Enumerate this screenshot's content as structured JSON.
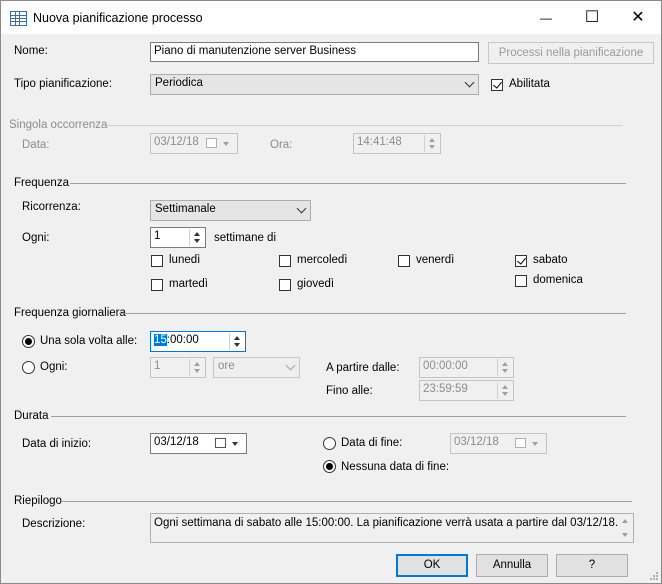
{
  "window": {
    "title": "Nuova pianificazione processo",
    "minimize_glyph": "—",
    "maximize_glyph": "☐",
    "close_glyph": "✕"
  },
  "general": {
    "name_label": "Nome:",
    "name_value": "Piano di manutenzione server Business",
    "jobs_button": "Processi nella pianificazione",
    "schedule_type_label": "Tipo pianificazione:",
    "schedule_type_value": "Periodica",
    "enabled_label": "Abilitata",
    "enabled_checked": true
  },
  "one_time": {
    "header": "Singola occorrenza",
    "date_label": "Data:",
    "date_value": "03/12/18",
    "time_label": "Ora:",
    "time_value": "14:41:48"
  },
  "frequency": {
    "header": "Frequenza",
    "occurs_label": "Ricorrenza:",
    "occurs_value": "Settimanale",
    "every_label": "Ogni:",
    "every_value": "1",
    "every_suffix": "settimane di",
    "days": [
      {
        "label": "lunedì",
        "checked": false
      },
      {
        "label": "martedì",
        "checked": false
      },
      {
        "label": "mercoledì",
        "checked": false
      },
      {
        "label": "giovedì",
        "checked": false
      },
      {
        "label": "venerdì",
        "checked": false
      },
      {
        "label": "sabato",
        "checked": true
      },
      {
        "label": "domenica",
        "checked": false
      }
    ]
  },
  "daily": {
    "header": "Frequenza giornaliera",
    "once_label": "Una sola volta alle:",
    "once_selected": true,
    "once_hour_selected": "15",
    "once_time_rest": ":00:00",
    "every_label": "Ogni:",
    "every_value": "1",
    "every_unit": "ore",
    "start_label": "A partire dalle:",
    "start_value": "00:00:00",
    "end_label": "Fino alle:",
    "end_value": "23:59:59"
  },
  "duration": {
    "header": "Durata",
    "start_label": "Data di inizio:",
    "start_value": "03/12/18",
    "end_label": "Data di fine:",
    "end_value": "03/12/18",
    "no_end_label": "Nessuna data di fine:",
    "no_end_selected": true
  },
  "summary": {
    "header": "Riepilogo",
    "description_label": "Descrizione:",
    "description_value": "Ogni settimana di sabato alle 15:00:00. La pianificazione verrà usata a partire dal 03/12/18."
  },
  "buttons": {
    "ok": "OK",
    "cancel": "Annulla",
    "help": "?"
  }
}
